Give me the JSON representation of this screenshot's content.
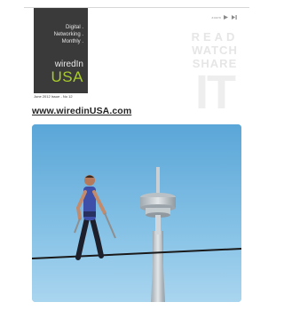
{
  "magazine": {
    "tagline": [
      "Digital .",
      "Networking .",
      "Monthly ."
    ],
    "logo_top": "wiredIn",
    "logo_bottom": "USA",
    "issue": "June 2012 Issue - No 12",
    "url": "www.wiredinUSA.com"
  },
  "nav": {
    "label": "zoom",
    "next_icon": "play-icon",
    "last_icon": "skip-forward-icon"
  },
  "slogan": {
    "read": "READ",
    "watch": "WATCH",
    "share": "SHARE",
    "it": "IT"
  },
  "colors": {
    "brand_dark": "#3a3a3a",
    "brand_green": "#a9cc2a",
    "sky": "#79b8e0"
  }
}
